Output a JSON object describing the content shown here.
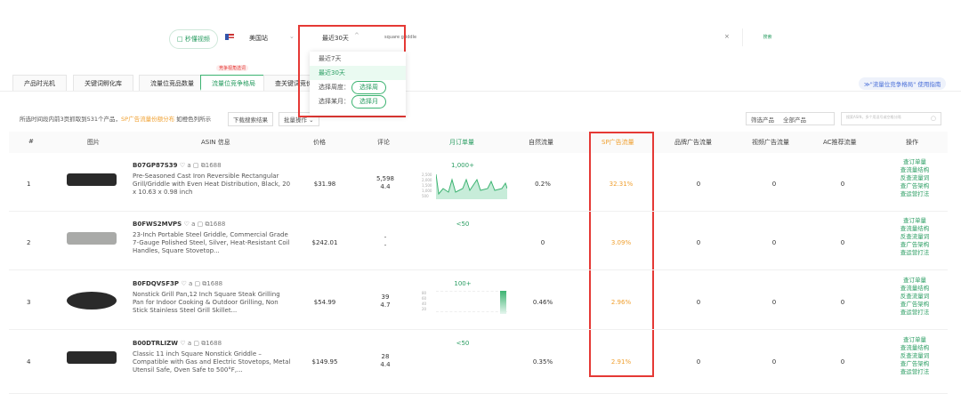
{
  "toolbar": {
    "video_btn": "□ 秒懂视频",
    "site": "美国站",
    "period": "最近30天",
    "keyword": "square griddle",
    "clear": "×",
    "search": "搜索"
  },
  "dropdown": {
    "options": [
      "最近7天",
      "最近30天"
    ],
    "week_label": "选择周度：",
    "week_btn": "选择周",
    "month_label": "选择某月：",
    "month_btn": "选择月",
    "selected": "最近30天"
  },
  "tabs": [
    {
      "label": "产品时光机"
    },
    {
      "label": "关键词孵化库"
    },
    {
      "label": "流量位竞品数量"
    },
    {
      "label": "流量位竞争格局",
      "active": true
    },
    {
      "label": "查关键词竞价"
    }
  ],
  "tab_badge": "竞争视角选词",
  "guide": "≫\"流量位竞争格局\" 使用指南",
  "info": {
    "text": "所选时间段内前3页抓取到531个产品，",
    "highlight": "SP广告流量份额分布",
    "text2": " 如橙色列所示",
    "download": "下载搜索结果",
    "batch": "批量操作 ⌄"
  },
  "filter": {
    "label": "筛选产品",
    "value": "全部产品",
    "search_placeholder": "搜索ASIN，多个用逗号或空格分隔"
  },
  "columns": [
    "#",
    "图片",
    "ASIN 信息",
    "价格",
    "评论",
    "月订单量",
    "自然流量",
    "SP广告流量",
    "品牌广告流量",
    "视频广告流量",
    "AC推荐流量",
    "操作"
  ],
  "actions": [
    "查订单量",
    "查流量结构",
    "反查流量词",
    "查广告架构",
    "查运营打法"
  ],
  "accent": "#2a9d62",
  "highlight_color": "#f0a030",
  "rows": [
    {
      "num": "1",
      "asin": "B07GP87S39",
      "icons": "♡ a ▢ ⧉1688",
      "title": "Pre-Seasoned Cast Iron Reversible Rectangular Grill/Griddle with Even Heat Distribution, Black, 20 x 10.63 x 0.98 inch",
      "price": "$31.98",
      "reviews": "5,598",
      "rating": "4.4",
      "orders": "1,000+",
      "chart_ticks": [
        "2,500",
        "2,000",
        "1,500",
        "1,000",
        "500"
      ],
      "organic": "0.2%",
      "sp": "32.31%",
      "brand": "0",
      "video": "0",
      "ac": "0"
    },
    {
      "num": "2",
      "asin": "B0FWS2MVPS",
      "icons": "♡ a ▢ ⧉1688",
      "title": "23-Inch Portable Steel Griddle, Commercial Grade 7-Gauge Polished Steel, Silver, Heat-Resistant Coil Handles, Square Stovetop...",
      "price": "$242.01",
      "reviews": "-",
      "rating": "-",
      "orders": "<50",
      "organic": "0",
      "sp": "3.09%",
      "brand": "0",
      "video": "0",
      "ac": "0"
    },
    {
      "num": "3",
      "asin": "B0FDQVSF3P",
      "icons": "♡ a ▢ ⧉1688",
      "title": "Nonstick Grill Pan,12 Inch Square Steak Grilling Pan for Indoor Cooking & Outdoor Grilling, Non Stick Stainless Steel Grill Skillet...",
      "price": "$54.99",
      "reviews": "39",
      "rating": "4.7",
      "orders": "100+",
      "chart_ticks": [
        "80",
        "60",
        "40",
        "20"
      ],
      "organic": "0.46%",
      "sp": "2.96%",
      "brand": "0",
      "video": "0",
      "ac": "0"
    },
    {
      "num": "4",
      "asin": "B00DTRLIZW",
      "icons": "♡ a ▢ ⧉1688",
      "title": "Classic 11 inch Square Nonstick Griddle – Compatible with Gas and Electric Stovetops, Metal Utensil Safe, Oven Safe to 500°F,...",
      "price": "$149.95",
      "reviews": "28",
      "rating": "4.4",
      "orders": "<50",
      "organic": "0.35%",
      "sp": "2.91%",
      "brand": "0",
      "video": "0",
      "ac": "0"
    }
  ]
}
